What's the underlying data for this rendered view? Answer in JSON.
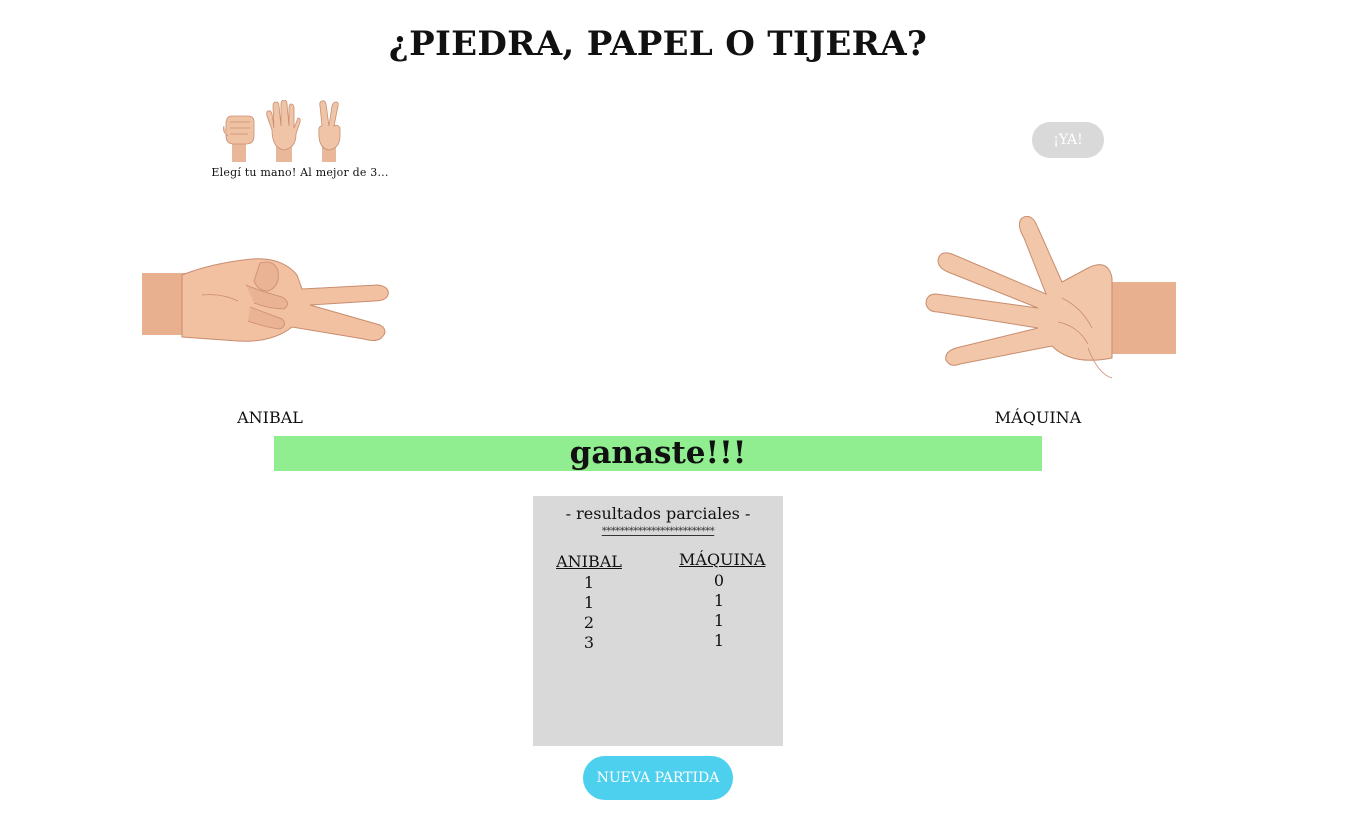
{
  "title": "¿PIEDRA, PAPEL O TIJERA?",
  "choices": {
    "rock_icon": "rock-hand-icon",
    "paper_icon": "paper-hand-icon",
    "scissors_icon": "scissors-hand-icon",
    "instruction": "Elegí tu mano! Al mejor de 3..."
  },
  "ya_button": "¡YA!",
  "player": {
    "name": "ANIBAL",
    "hand": "scissors-hand-icon"
  },
  "machine": {
    "name": "MÁQUINA",
    "hand": "paper-hand-icon"
  },
  "result": {
    "text": "ganaste!!!",
    "color": "#90ee90"
  },
  "scoreboard": {
    "title": "- resultados parciales -",
    "divider": "*************************",
    "player_header": "ANIBAL",
    "machine_header": "MÁQUINA",
    "player_scores": [
      "1",
      "1",
      "2",
      "3"
    ],
    "machine_scores": [
      "0",
      "1",
      "1",
      "1"
    ]
  },
  "new_game_button": "NUEVA PARTIDA",
  "colors": {
    "result_bar": "#90ee90",
    "scoreboard_bg": "#d9d9d9",
    "ya_button_bg": "#d9d9d9",
    "new_game_bg": "#4dcfee"
  }
}
